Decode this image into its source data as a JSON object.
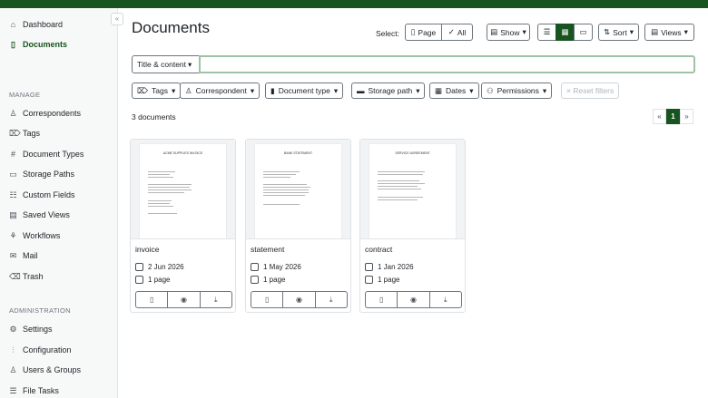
{
  "sidebar": {
    "nav": [
      {
        "label": "Dashboard",
        "icon": "house-icon",
        "glyph": "⌂"
      },
      {
        "label": "Documents",
        "icon": "file-icon",
        "glyph": "▯",
        "active": true
      }
    ],
    "manage_heading": "MANAGE",
    "manage": [
      {
        "label": "Correspondents",
        "icon": "person-icon",
        "glyph": "♙"
      },
      {
        "label": "Tags",
        "icon": "tag-icon",
        "glyph": "⌦"
      },
      {
        "label": "Document Types",
        "icon": "hash-icon",
        "glyph": "#"
      },
      {
        "label": "Storage Paths",
        "icon": "folder-icon",
        "glyph": "▭"
      },
      {
        "label": "Custom Fields",
        "icon": "ui-checks-icon",
        "glyph": "☷"
      },
      {
        "label": "Saved Views",
        "icon": "saved-view-icon",
        "glyph": "▤"
      },
      {
        "label": "Workflows",
        "icon": "workflow-icon",
        "glyph": "⚘"
      },
      {
        "label": "Mail",
        "icon": "mail-icon",
        "glyph": "✉"
      },
      {
        "label": "Trash",
        "icon": "trash-icon",
        "glyph": "⌫"
      }
    ],
    "admin_heading": "ADMINISTRATION",
    "admin": [
      {
        "label": "Settings",
        "icon": "gear-icon",
        "glyph": "⚙"
      },
      {
        "label": "Configuration",
        "icon": "sliders-icon",
        "glyph": "⫶"
      },
      {
        "label": "Users & Groups",
        "icon": "people-icon",
        "glyph": "♙"
      },
      {
        "label": "File Tasks",
        "icon": "list-task-icon",
        "glyph": "☰"
      }
    ],
    "collapse_glyph": "«"
  },
  "header": {
    "title": "Documents",
    "select_label": "Select:",
    "page_btn": "Page",
    "all_btn": "All",
    "show_btn": "Show",
    "sort_btn": "Sort",
    "views_btn": "Views"
  },
  "search": {
    "mode": "Title & content",
    "value": ""
  },
  "filters": [
    {
      "label": "Tags",
      "icon": "tag-icon",
      "glyph": "⌦"
    },
    {
      "label": "Correspondent",
      "icon": "person-icon",
      "glyph": "♙"
    },
    {
      "label": "Document type",
      "icon": "file-icon",
      "glyph": "▮"
    },
    {
      "label": "Storage path",
      "icon": "folder-icon",
      "glyph": "▬"
    },
    {
      "label": "Dates",
      "icon": "calendar-icon",
      "glyph": "▦"
    },
    {
      "label": "Permissions",
      "icon": "people-icon",
      "glyph": "⚇"
    }
  ],
  "reset_filters": "× Reset filters",
  "doc_count": "3 documents",
  "pager": {
    "prev": "«",
    "current": "1",
    "next": "»"
  },
  "documents": [
    {
      "title": "invoice",
      "heading": "ACME SUPPLIES INVOICE",
      "date": "2 Jun 2026",
      "pages": "1 page"
    },
    {
      "title": "statement",
      "heading": "BANK STATEMENT",
      "date": "1 May 2026",
      "pages": "1 page"
    },
    {
      "title": "contract",
      "heading": "SERVICE AGREEMENT",
      "date": "1 Jan 2026",
      "pages": "1 page"
    }
  ],
  "colors": {
    "accent": "#17541f",
    "focus": "#9fc2a5"
  }
}
